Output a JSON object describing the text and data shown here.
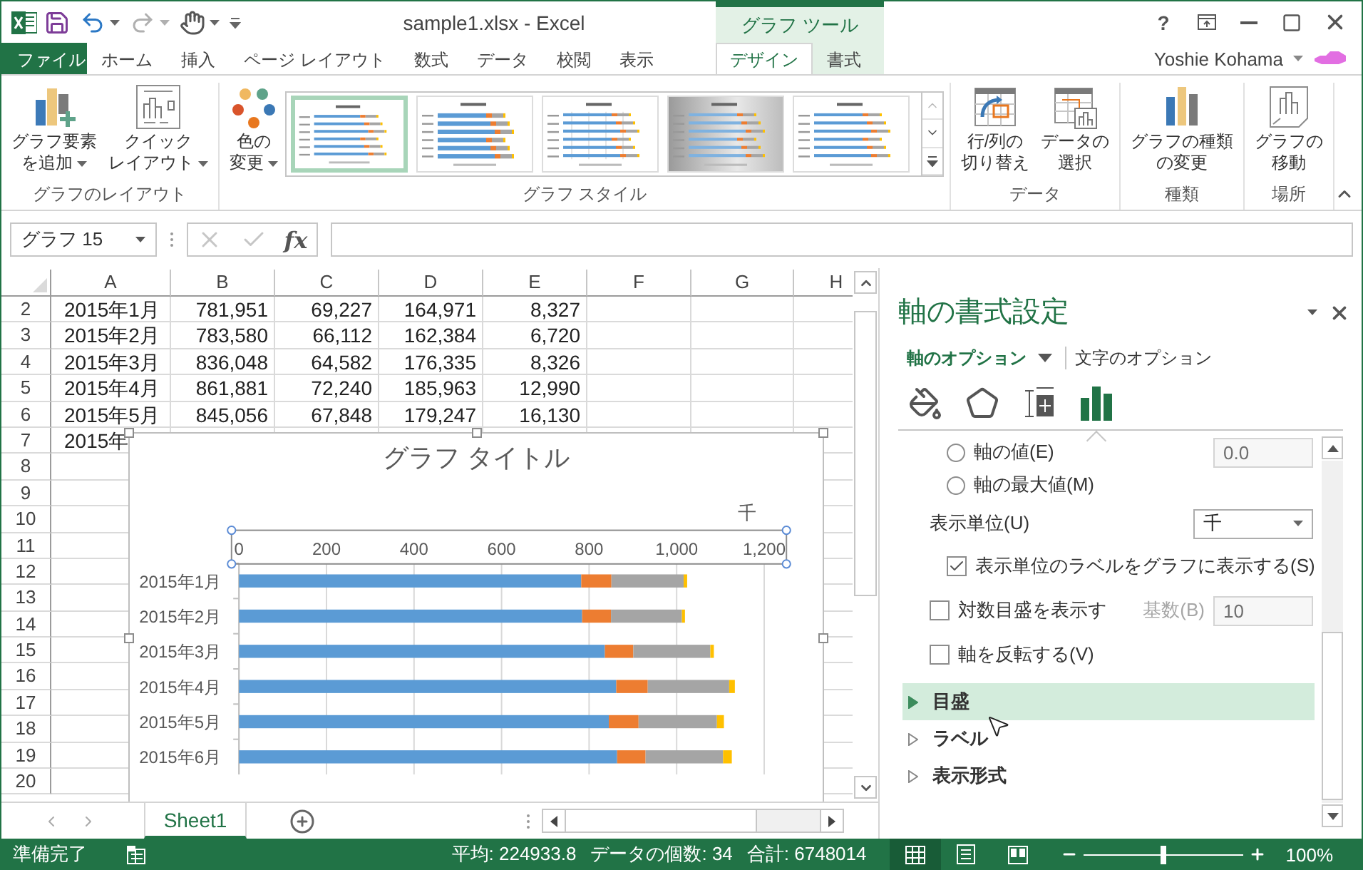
{
  "window": {
    "title": "sample1.xlsx - Excel",
    "context_group": "グラフ ツール",
    "help": "?",
    "user": "Yoshie Kohama"
  },
  "ribbon_tabs": [
    {
      "label": "ファイル",
      "kind": "file",
      "selected": false
    },
    {
      "label": "ホーム",
      "kind": "normal",
      "selected": false
    },
    {
      "label": "挿入",
      "kind": "normal",
      "selected": false
    },
    {
      "label": "ページ レイアウト",
      "kind": "normal",
      "selected": false
    },
    {
      "label": "数式",
      "kind": "normal",
      "selected": false
    },
    {
      "label": "データ",
      "kind": "normal",
      "selected": false
    },
    {
      "label": "校閲",
      "kind": "normal",
      "selected": false
    },
    {
      "label": "表示",
      "kind": "normal",
      "selected": false
    },
    {
      "label": "デザイン",
      "kind": "context",
      "selected": true
    },
    {
      "label": "書式",
      "kind": "context",
      "selected": false
    }
  ],
  "ribbon_groups": [
    {
      "label": "グラフのレイアウト",
      "buttons": [
        {
          "kind": "add_element",
          "lines": [
            "グラフ要素",
            "を追加"
          ],
          "dropdown": true
        },
        {
          "kind": "quick_layout",
          "lines": [
            "クイック",
            "レイアウト"
          ],
          "dropdown": true
        }
      ]
    },
    {
      "label": "グラフ スタイル",
      "buttons": [
        {
          "kind": "colors",
          "lines": [
            "色の",
            "変更"
          ],
          "dropdown": true
        }
      ],
      "styles": [
        {
          "kind": "plain",
          "selected": true
        },
        {
          "kind": "labeled",
          "selected": false
        },
        {
          "kind": "gridded",
          "selected": false
        },
        {
          "kind": "gradient",
          "selected": false
        },
        {
          "kind": "plain",
          "selected": false
        }
      ]
    },
    {
      "label": "データ",
      "buttons": [
        {
          "kind": "switch_rowcol",
          "lines": [
            "行/列の",
            "切り替え"
          ],
          "dropdown": false
        },
        {
          "kind": "select_data",
          "lines": [
            "データの",
            "選択"
          ],
          "dropdown": false
        }
      ]
    },
    {
      "label": "種類",
      "buttons": [
        {
          "kind": "change_type",
          "lines": [
            "グラフの種類",
            "の変更"
          ],
          "dropdown": false
        }
      ]
    },
    {
      "label": "場所",
      "buttons": [
        {
          "kind": "move_chart",
          "lines": [
            "グラフの",
            "移動"
          ],
          "dropdown": false
        }
      ]
    }
  ],
  "formula_bar": {
    "name_box": "グラフ 15",
    "function_button": "fx"
  },
  "sheet": {
    "columns": [
      "A",
      "B",
      "C",
      "D",
      "E",
      "F",
      "G",
      "H"
    ],
    "rows": [
      {
        "number": "2",
        "cells": [
          "2015年1月",
          "781,951",
          "69,227",
          "164,971",
          "8,327"
        ]
      },
      {
        "number": "3",
        "cells": [
          "2015年2月",
          "783,580",
          "66,112",
          "162,384",
          "6,720"
        ]
      },
      {
        "number": "4",
        "cells": [
          "2015年3月",
          "836,048",
          "64,582",
          "176,335",
          "8,326"
        ]
      },
      {
        "number": "5",
        "cells": [
          "2015年4月",
          "861,881",
          "72,240",
          "185,963",
          "12,990"
        ]
      },
      {
        "number": "6",
        "cells": [
          "2015年5月",
          "845,056",
          "67,848",
          "179,247",
          "16,130"
        ]
      },
      {
        "number": "7",
        "cells": [
          "2015年"
        ]
      },
      {
        "number": "8"
      },
      {
        "number": "9"
      },
      {
        "number": "10"
      },
      {
        "number": "11"
      },
      {
        "number": "12"
      },
      {
        "number": "13"
      },
      {
        "number": "14"
      },
      {
        "number": "15"
      },
      {
        "number": "16"
      },
      {
        "number": "17"
      },
      {
        "number": "18"
      },
      {
        "number": "19"
      },
      {
        "number": "20"
      }
    ]
  },
  "chart": {
    "title": "グラフ タイトル",
    "display_unit_label": "千",
    "axis_selected": true,
    "chart_data": {
      "type": "bar",
      "orientation": "horizontal",
      "stacked": true,
      "categories": [
        "2015年1月",
        "2015年2月",
        "2015年3月",
        "2015年4月",
        "2015年5月",
        "2015年6月"
      ],
      "series": [
        {
          "color": "#5b9bd5",
          "values": [
            782,
            784,
            836,
            862,
            845,
            864
          ]
        },
        {
          "color": "#ed7d31",
          "values": [
            69,
            66,
            65,
            72,
            68,
            65
          ]
        },
        {
          "color": "#a5a5a5",
          "values": [
            165,
            162,
            176,
            186,
            179,
            177
          ]
        },
        {
          "color": "#ffc000",
          "values": [
            8,
            7,
            8,
            13,
            16,
            20
          ]
        }
      ],
      "grid": true,
      "xlim": [
        0,
        1200
      ],
      "xticks": [
        0,
        200,
        400,
        600,
        800,
        {
          "value": 1000,
          "label": "1,000"
        },
        {
          "value": 1200,
          "label": "1,200"
        }
      ]
    }
  },
  "sheet_tabs": [
    {
      "label": "Sheet1",
      "selected": true
    }
  ],
  "pane": {
    "title": "軸の書式設定",
    "option_tabs": [
      {
        "label": "軸のオプション",
        "selected": true
      },
      {
        "label": "文字のオプション",
        "selected": false
      }
    ],
    "icon_tabs": [
      {
        "kind": "fill",
        "selected": false
      },
      {
        "kind": "effects",
        "selected": false
      },
      {
        "kind": "size",
        "selected": false
      },
      {
        "kind": "axis",
        "selected": true
      }
    ],
    "options": [
      {
        "kind": "radio",
        "label": "軸の値(E)",
        "checked": false,
        "field": {
          "value": "0.0",
          "disabled": true
        }
      },
      {
        "kind": "radio",
        "label": "軸の最大値(M)",
        "checked": false
      },
      {
        "kind": "select",
        "label": "表示単位(U)",
        "value": "千",
        "children": [
          {
            "kind": "checkbox",
            "label": "表示単位のラベルをグラフに表示する(S)",
            "checked": true
          }
        ]
      },
      {
        "kind": "checkbox",
        "label": "対数目盛を表示す",
        "checked": false,
        "field_label": "基数(B)",
        "field": {
          "value": "10",
          "disabled": true
        }
      },
      {
        "kind": "checkbox",
        "label": "軸を反転する(V)",
        "checked": false
      }
    ],
    "sections": [
      {
        "label": "目盛",
        "expanded": false,
        "hovered": true
      },
      {
        "label": "ラベル",
        "expanded": false,
        "hovered": false
      },
      {
        "label": "表示形式",
        "expanded": false,
        "hovered": false
      }
    ]
  },
  "status_bar": {
    "status": "準備完了",
    "average": "平均: 224933.8",
    "count": "データの個数: 34",
    "sum": "合計: 6748014",
    "views": [
      {
        "kind": "normal",
        "selected": true
      },
      {
        "kind": "page_layout",
        "selected": false
      },
      {
        "kind": "page_break",
        "selected": false
      }
    ],
    "zoom": {
      "level": 0.5,
      "label": "100%"
    }
  }
}
